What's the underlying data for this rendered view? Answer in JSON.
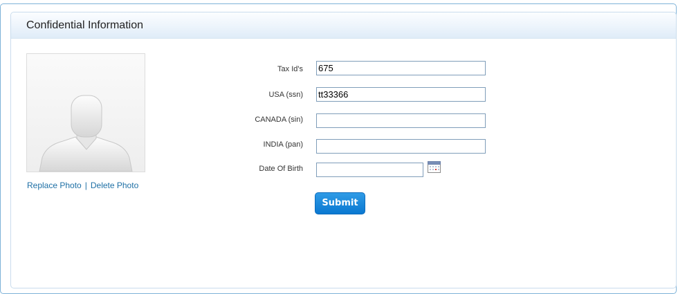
{
  "panel": {
    "title": "Confidential Information"
  },
  "photo": {
    "avatar_icon": "default-user-silhouette",
    "replace_label": "Replace Photo",
    "separator": "|",
    "delete_label": "Delete Photo"
  },
  "form": {
    "fields": [
      {
        "label": "Tax Id's",
        "value": "675"
      },
      {
        "label": "USA (ssn)",
        "value": "tt33366"
      },
      {
        "label": "CANADA (sin)",
        "value": ""
      },
      {
        "label": "INDIA (pan)",
        "value": ""
      },
      {
        "label": "Date Of Birth",
        "value": ""
      }
    ],
    "calendar_icon": "calendar-icon",
    "submit_label": "Submit"
  },
  "colors": {
    "accent": "#0a78d1",
    "link": "#1d6fa5",
    "border": "#7db2d8"
  }
}
